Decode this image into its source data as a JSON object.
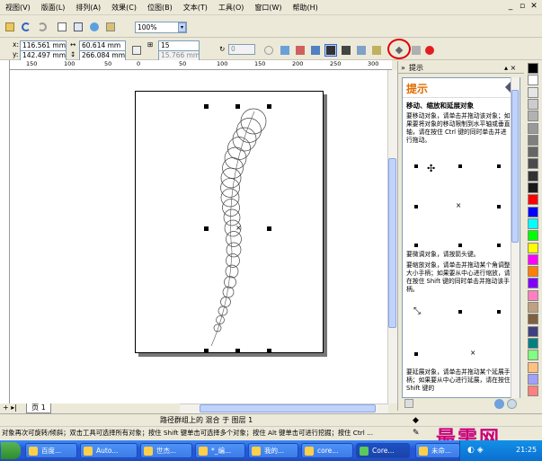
{
  "menu": {
    "items": [
      "视图(V)",
      "版面(L)",
      "排列(A)",
      "效果(C)",
      "位图(B)",
      "文本(T)",
      "工具(O)",
      "窗口(W)",
      "帮助(H)"
    ]
  },
  "toolbar": {
    "zoom_value": "100%"
  },
  "property_bar": {
    "x_label": "x:",
    "x_value": "116.561 mm",
    "y_label": "y:",
    "y_value": "142.497 mm",
    "w_value": "60.614 mm",
    "h_value": "266.084 mm",
    "steps_value": "15",
    "spacing_value": "15.766 mm",
    "angle_value": "0"
  },
  "rulers": {
    "h_ticks": [
      "150",
      "100",
      "50",
      "0",
      "50",
      "100",
      "150",
      "200",
      "250",
      "300"
    ]
  },
  "page_tabs": {
    "nav": "+ ▸|",
    "page1": "页 1"
  },
  "docker": {
    "title": "提示",
    "panel_title": "提示",
    "subtitle": "移动、缩放和延展对象",
    "hint1": "要移动对象，请单击并拖动该对象；如果要将对象的移动限制到水平轴或垂直轴，请在按住 Ctrl 键的同时单击并进行拖动。",
    "hint2": "要微调对象，请按箭头键。",
    "hint3": "要缩放对象，请单击并拖动某个角调整大小手柄；如果要从中心进行缩放，请在按住 Shift 键的同时单击并拖动该手柄。",
    "hint4": "要延展对象，请单击并拖动某个延展手柄；如果要从中心进行延展，请在按住 Shift 键的"
  },
  "status": {
    "line1": "路径群组上的 混合 于 图层 1",
    "line2": "对象再次可旋转/倾斜；双击工具可选择所有对象；按住 Shift 键单击可选择多个对象；按住 Alt 键单击可进行挖掘；按住 Ctrl ..."
  },
  "taskbar": {
    "tasks": [
      "百度...",
      "Auto...",
      "世杰...",
      "*_编...",
      "我的...",
      "core...",
      "Core...",
      "未命..."
    ],
    "clock": "21:25"
  },
  "watermark": "最需网",
  "colors": {
    "accent": "#e06c00",
    "taskbar": "#2458d9",
    "highlight_circle": "#e00000"
  },
  "palette": [
    "#000000",
    "#ffffff",
    "#e5e5e5",
    "#cccccc",
    "#b2b2b2",
    "#999999",
    "#7f7f7f",
    "#666666",
    "#4c4c4c",
    "#333333",
    "#1a1a1a",
    "#ff0000",
    "#0000ff",
    "#00ffff",
    "#00ff00",
    "#ffff00",
    "#ff00ff",
    "#ff8000",
    "#8000ff",
    "#ff80c0",
    "#c0a080",
    "#806040",
    "#404080",
    "#008080",
    "#80ff80",
    "#ffc080",
    "#a0a0ff",
    "#ff8080"
  ]
}
